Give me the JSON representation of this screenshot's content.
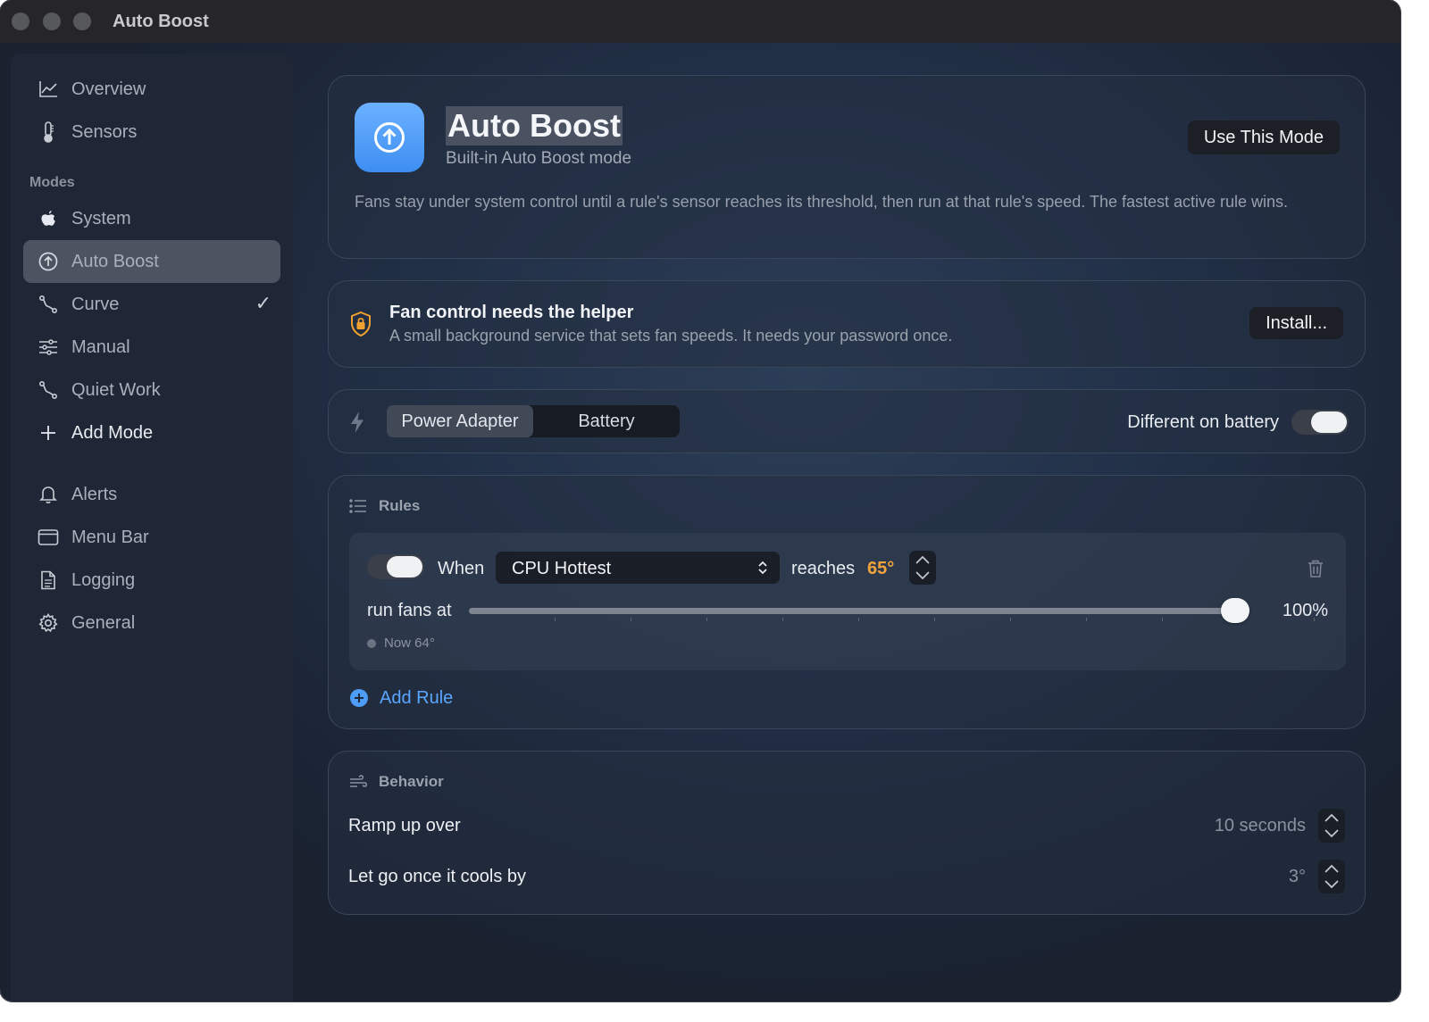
{
  "window": {
    "title": "Auto Boost"
  },
  "sidebar": {
    "top_items": [
      {
        "label": "Overview",
        "icon": "chart-line-icon"
      },
      {
        "label": "Sensors",
        "icon": "thermometer-icon"
      }
    ],
    "modes_heading": "Modes",
    "modes": [
      {
        "label": "System",
        "icon": "apple-icon"
      },
      {
        "label": "Auto Boost",
        "icon": "arrow-up-circle-icon",
        "selected": true
      },
      {
        "label": "Curve",
        "icon": "curve-icon",
        "checked": true
      },
      {
        "label": "Manual",
        "icon": "sliders-icon"
      },
      {
        "label": "Quiet Work",
        "icon": "curve-icon"
      },
      {
        "label": "Add Mode",
        "icon": "plus-icon"
      }
    ],
    "bottom_items": [
      {
        "label": "Alerts",
        "icon": "bell-icon"
      },
      {
        "label": "Menu Bar",
        "icon": "window-icon"
      },
      {
        "label": "Logging",
        "icon": "document-icon"
      },
      {
        "label": "General",
        "icon": "gear-icon"
      }
    ],
    "check_glyph": "✓"
  },
  "header": {
    "title": "Auto Boost",
    "subtitle": "Built-in Auto Boost mode",
    "use_button": "Use This Mode",
    "description": "Fans stay under system control until a rule's sensor reaches its threshold, then run at that rule's speed. The fastest active rule wins."
  },
  "helper": {
    "title": "Fan control needs the helper",
    "subtitle": "A small background service that sets fan speeds. It needs your password once.",
    "install_button": "Install..."
  },
  "power": {
    "segments": [
      "Power Adapter",
      "Battery"
    ],
    "selected_segment": "Power Adapter",
    "different_on_battery_label": "Different on battery",
    "different_on_battery": true
  },
  "rules": {
    "heading": "Rules",
    "items": [
      {
        "enabled": true,
        "when_label": "When",
        "sensor": "CPU Hottest",
        "reaches_label": "reaches",
        "threshold": "65°",
        "run_label": "run fans at",
        "speed_percent": 100,
        "speed_text": "100%",
        "now_text": "Now 64°"
      }
    ],
    "add_rule": "Add Rule"
  },
  "behavior": {
    "heading": "Behavior",
    "rows": [
      {
        "label": "Ramp up over",
        "value": "10 seconds"
      },
      {
        "label": "Let go once it cools by",
        "value": "3°"
      }
    ]
  },
  "colors": {
    "accent_blue": "#5aa6ff",
    "threshold_orange": "#f2a33a",
    "helper_lock_orange": "#f0a030",
    "app_icon_blue": "#4d9cf7"
  }
}
